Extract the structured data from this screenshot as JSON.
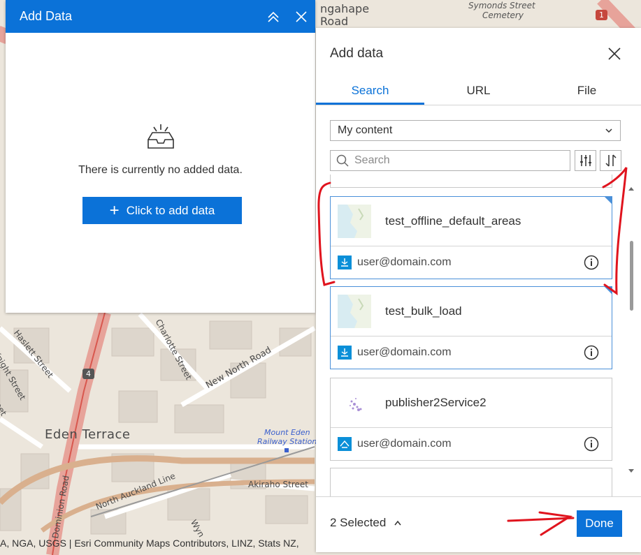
{
  "map": {
    "labels": {
      "karangahape": "ngahape",
      "road_top": "Road",
      "cemetery_1": "Symonds Street",
      "cemetery_2": "Cemetery",
      "hwy_1": "1",
      "hwy_4": "4",
      "hazlett": "Haslett Street",
      "charlotte": "Charlotte Street",
      "new_north": "New North Road",
      "eden_terrace": "Eden Terrace",
      "mount_eden_1": "Mount Eden",
      "mount_eden_2": "Railway Station",
      "north_auckland": "North Auckland Line",
      "akiraho": "Akiraho Street",
      "dominion": "Dominion Road",
      "knight": "Knight Street",
      "street_left": "reet",
      "wyn": "Wyn"
    },
    "attribution": "A, NGA, USGS | Esri Community Maps Contributors, LINZ, Stats NZ,"
  },
  "left_panel": {
    "title": "Add Data",
    "empty_text": "There is currently no added data.",
    "add_button": "Click to add data",
    "icons": [
      "collapse-icon",
      "close-icon",
      "empty-inbox-icon",
      "plus-icon"
    ]
  },
  "right_panel": {
    "title": "Add data",
    "tabs": [
      "Search",
      "URL",
      "File"
    ],
    "active_tab": "Search",
    "source_select": "My content",
    "search_placeholder": "Search",
    "items": [
      {
        "name": "test_offline_default_areas",
        "owner": "user@domain.com",
        "selected": true
      },
      {
        "name": "test_bulk_load",
        "owner": "user@domain.com",
        "selected": true
      },
      {
        "name": "publisher2Service2",
        "owner": "user@domain.com",
        "selected": false
      }
    ],
    "footer": {
      "selected_text": "2 Selected",
      "done": "Done"
    }
  },
  "colors": {
    "brand_blue": "#0b72d8",
    "annotation_red": "#e0141e"
  }
}
